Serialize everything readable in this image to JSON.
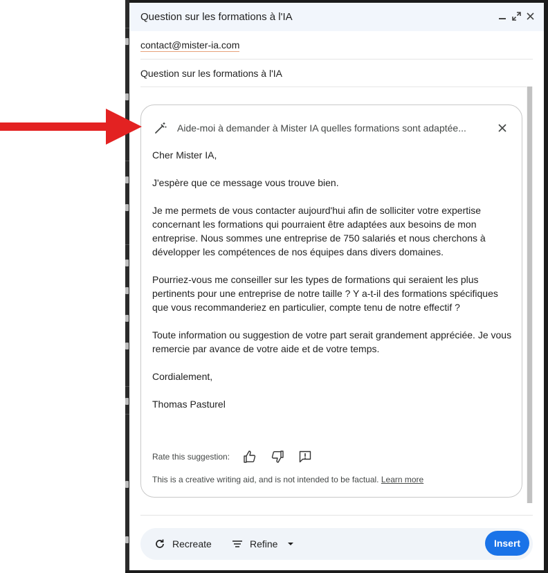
{
  "compose": {
    "title": "Question sur les formations à l'IA",
    "recipient": "contact@mister-ia.com",
    "subject": "Question sur les formations à l'IA"
  },
  "suggestion": {
    "prompt": "Aide-moi à demander à Mister IA quelles formations sont adaptée...",
    "paragraphs": [
      "Cher Mister IA,",
      "J'espère que ce message vous trouve bien.",
      "Je me permets de vous contacter aujourd'hui afin de solliciter votre expertise concernant les formations qui pourraient être adaptées aux besoins de mon entreprise. Nous sommes une entreprise de 750 salariés et nous cherchons à développer les compétences de nos équipes dans divers domaines.",
      "Pourriez-vous me conseiller sur les types de formations qui seraient les plus pertinents pour une entreprise de notre taille ? Y a-t-il des formations spécifiques que vous recommanderiez en particulier, compte tenu de notre effectif ?",
      "Toute information ou suggestion de votre part serait grandement appréciée. Je vous remercie par avance de votre aide et de votre temps.",
      "Cordialement,",
      "Thomas Pasturel"
    ],
    "rate_label": "Rate this suggestion:",
    "disclaimer": "This is a creative writing aid, and is not intended to be factual.",
    "learn_more": "Learn more"
  },
  "actions": {
    "recreate": "Recreate",
    "refine": "Refine",
    "insert": "Insert"
  },
  "colors": {
    "accent": "#1a73e8",
    "titlebar": "#f2f6fc",
    "action_bar": "#f0f4f9",
    "arrow": "#e32222"
  },
  "icons": [
    "minimize-icon",
    "expand-icon",
    "close-icon",
    "magic-wand-icon",
    "thumbs-up-icon",
    "thumbs-down-icon",
    "report-icon",
    "refresh-icon",
    "refine-icon",
    "caret-down-icon"
  ]
}
